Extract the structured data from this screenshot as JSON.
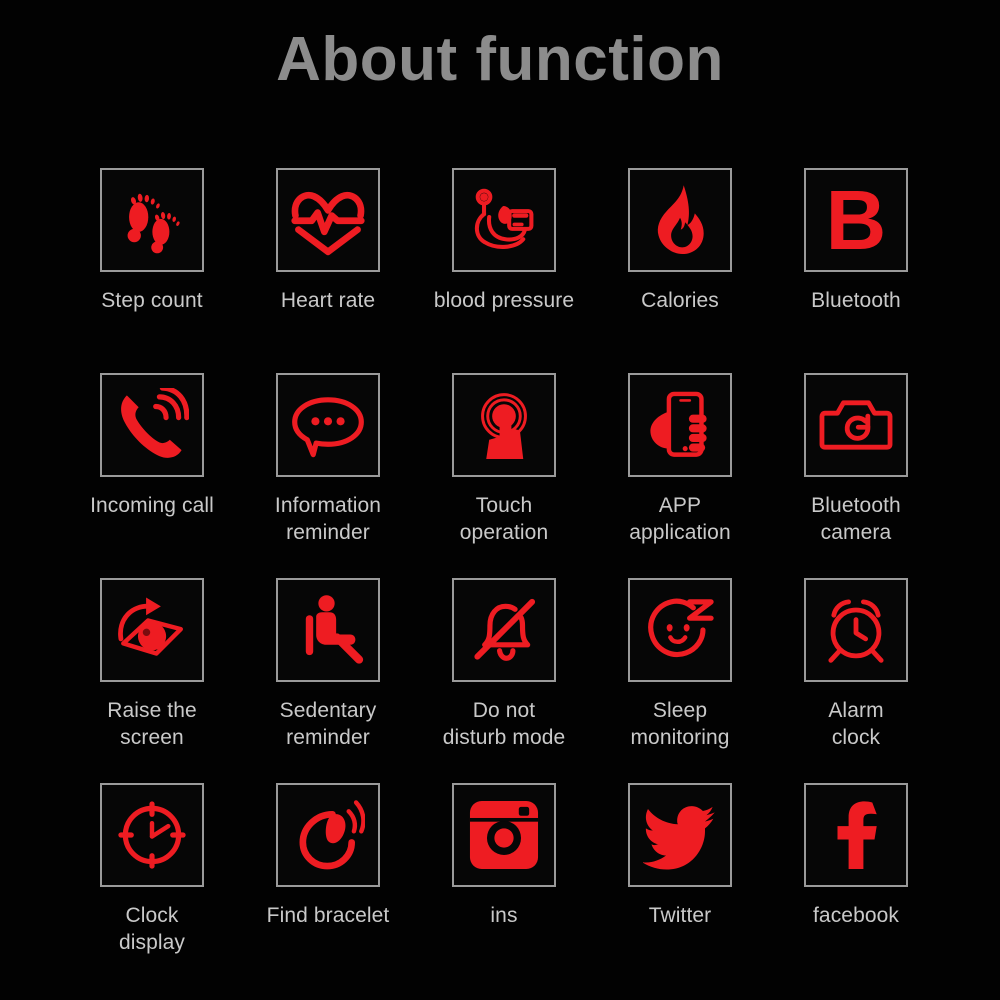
{
  "header": {
    "title": "About function"
  },
  "theme": {
    "background": "#020202",
    "icon_red": "#ee1c22",
    "label_gray": "#c9c9c9",
    "title_gray": "#8c8c8c",
    "box_border_gray": "#9a9a9a"
  },
  "grid": {
    "columns": 5,
    "rows": 4,
    "items": [
      {
        "label": "Step count",
        "icon": "footprints-icon"
      },
      {
        "label": "Heart rate",
        "icon": "heart-pulse-icon"
      },
      {
        "label": "blood pressure",
        "icon": "blood-pressure-cuff-icon"
      },
      {
        "label": "Calories",
        "icon": "flame-icon"
      },
      {
        "label": "Bluetooth",
        "icon": "letter-b-icon"
      },
      {
        "label": "Incoming call",
        "icon": "ringing-phone-icon"
      },
      {
        "label": "Information\nreminder",
        "icon": "speech-bubble-icon"
      },
      {
        "label": "Touch\noperation",
        "icon": "finger-tap-icon"
      },
      {
        "label": "APP\napplication",
        "icon": "hand-holding-phone-icon"
      },
      {
        "label": "Bluetooth\ncamera",
        "icon": "camera-icon"
      },
      {
        "label": "Raise the\nscreen",
        "icon": "eye-rotate-icon"
      },
      {
        "label": "Sedentary\nreminder",
        "icon": "seated-person-icon"
      },
      {
        "label": "Do not\ndisturb mode",
        "icon": "bell-slash-icon"
      },
      {
        "label": "Sleep\nmonitoring",
        "icon": "sleepy-face-z-icon"
      },
      {
        "label": "Alarm\nclock",
        "icon": "alarm-clock-icon"
      },
      {
        "label": "Clock\ndisplay",
        "icon": "clock-face-icon"
      },
      {
        "label": "Find bracelet",
        "icon": "vibrating-bracelet-icon"
      },
      {
        "label": "ins",
        "icon": "instagram-icon"
      },
      {
        "label": "Twitter",
        "icon": "twitter-bird-icon"
      },
      {
        "label": "facebook",
        "icon": "facebook-f-icon"
      }
    ]
  }
}
